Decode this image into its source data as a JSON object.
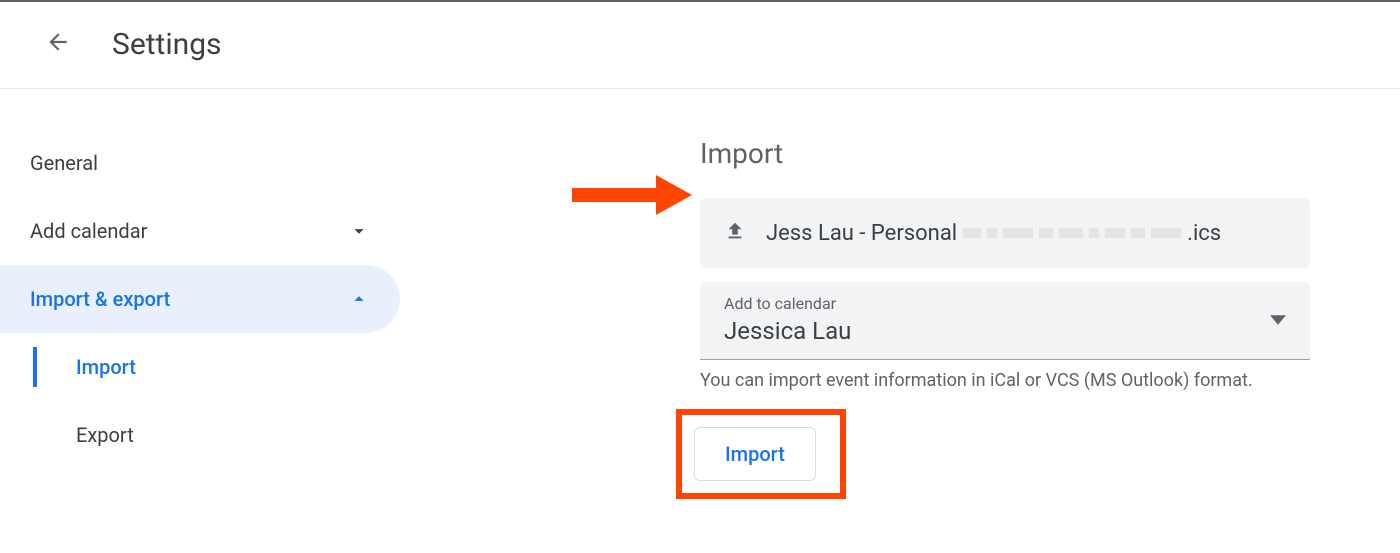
{
  "header": {
    "title": "Settings"
  },
  "sidebar": {
    "general": "General",
    "add_calendar": "Add calendar",
    "import_export": "Import & export",
    "sub_import": "Import",
    "sub_export": "Export"
  },
  "main": {
    "heading": "Import",
    "file_prefix": "Jess Lau - Personal",
    "file_suffix": ".ics",
    "select_label": "Add to calendar",
    "select_value": "Jessica Lau",
    "helper": "You can import event information in iCal or VCS (MS Outlook) format.",
    "import_button": "Import"
  }
}
